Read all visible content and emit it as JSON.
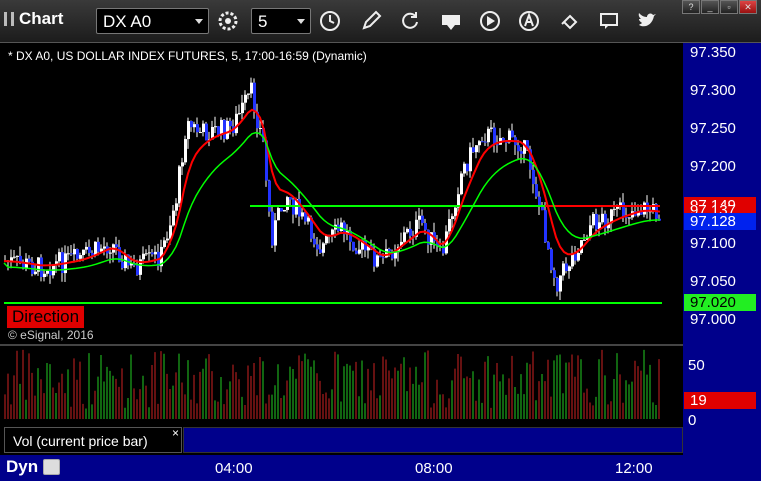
{
  "toolbar": {
    "app_title": "Chart",
    "symbol": "DX A0",
    "interval": "5",
    "icons": [
      "settings-gear-icon",
      "clock-icon",
      "pencil-icon",
      "refresh-icon",
      "get-icon",
      "play-icon",
      "alert-icon",
      "link-icon",
      "chat-icon",
      "twitter-icon"
    ]
  },
  "window_buttons": [
    "?",
    "_",
    "▫",
    "✕"
  ],
  "chart": {
    "label": "* DX A0, US DOLLAR INDEX FUTURES, 5, 17:00-16:59 (Dynamic)",
    "copyright": "© eSignal, 2016",
    "direction_label": "Direction",
    "price_axis": [
      "97.350",
      "97.300",
      "97.250",
      "97.200",
      "97.150",
      "97.100",
      "97.050",
      "97.000"
    ],
    "price_tags": {
      "red": "97.149",
      "white": "97.137",
      "blue": "97.128",
      "green": "97.020"
    },
    "colors": {
      "up": "#ffffff",
      "down": "#2233ff",
      "ma_fast": "#ff0000",
      "ma_slow": "#00ff00",
      "level": "#00ff00",
      "axis_text": "#ffffff"
    }
  },
  "volume": {
    "label": "Vol (current price bar)",
    "close_glyph": "×",
    "axis": [
      "50",
      "0"
    ],
    "current_tag": "19"
  },
  "footer": {
    "mode": "Dyn",
    "time_labels": [
      "04:00",
      "08:00",
      "12:00"
    ]
  },
  "chart_data": {
    "type": "candlestick",
    "symbol": "DX A0",
    "ylim": [
      96.98,
      97.36
    ],
    "yticks": [
      97.35,
      97.3,
      97.25,
      97.2,
      97.15,
      97.1,
      97.05,
      97.0
    ],
    "horizontal_level": 97.02,
    "last_price": 97.128
  }
}
